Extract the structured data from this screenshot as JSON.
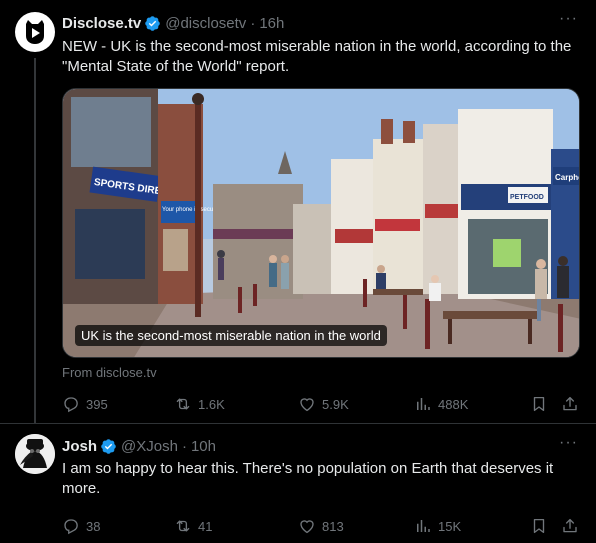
{
  "tweets": [
    {
      "author": {
        "name": "Disclose.tv",
        "handle": "@disclosetv",
        "time": "16h",
        "avatar_icon": "disclose-logo-icon",
        "verified": true
      },
      "text": "NEW - UK is the second-most miserable nation in the world, according to the \"Mental State of the World\" report.",
      "media": {
        "caption": "UK is the second-most miserable nation in the world"
      },
      "link_source": "From disclose.tv",
      "stats": {
        "replies": "395",
        "retweets": "1.6K",
        "likes": "5.9K",
        "views": "488K"
      }
    },
    {
      "author": {
        "name": "Josh",
        "handle": "@XJosh",
        "time": "10h",
        "avatar_icon": "plague-doctor-avatar-icon",
        "verified": true
      },
      "text": "I am so happy to hear this. There's no population on Earth that deserves it more.",
      "stats": {
        "replies": "38",
        "retweets": "41",
        "likes": "813",
        "views": "15K"
      }
    }
  ],
  "more_label": "···",
  "dot": "·",
  "scene_signs": {
    "shop1": "SPORTS DIRECT",
    "shop2": "PETFOOD",
    "shop3": "Carphone",
    "poster": "Your phone in secure"
  },
  "colors": {
    "background": "#000000",
    "text": "#e7e9ea",
    "muted": "#71767b",
    "verified": "#1d9bf0",
    "border": "#2f3336"
  }
}
